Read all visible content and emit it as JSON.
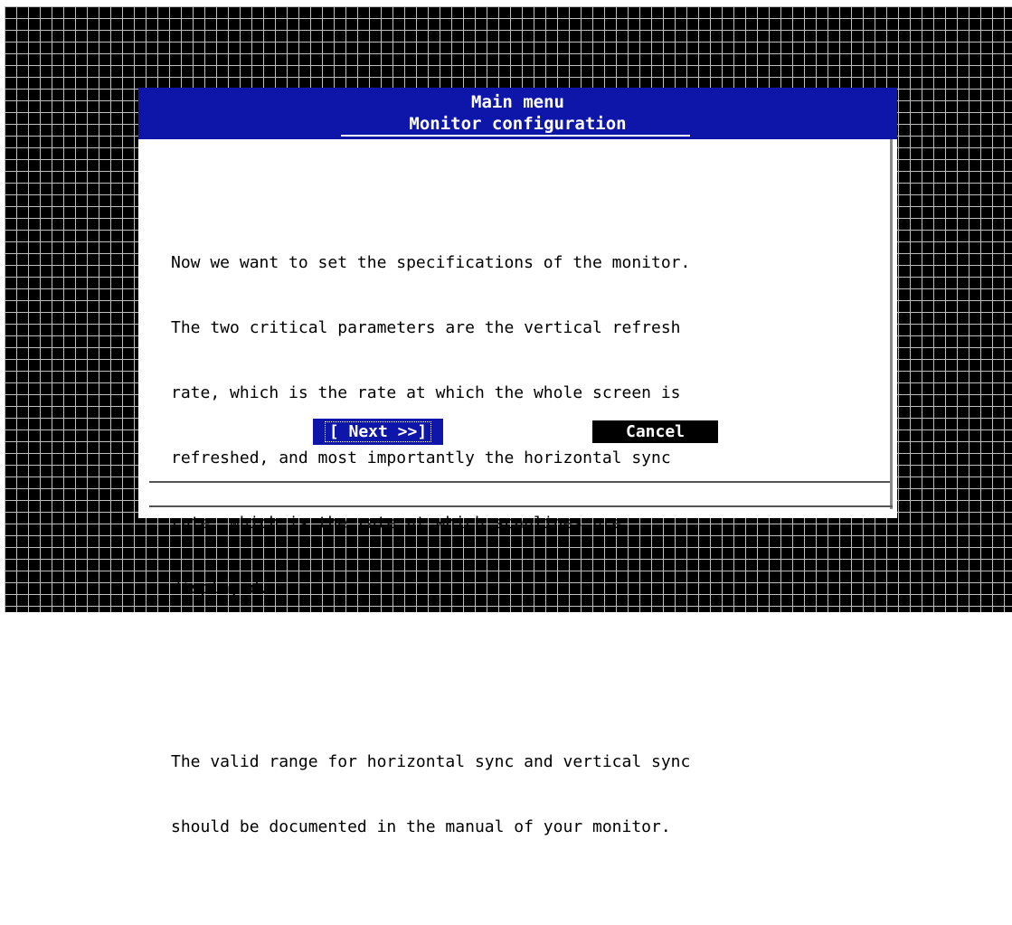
{
  "dialog": {
    "title": "Main menu",
    "subtitle": "Monitor configuration",
    "paragraph1": [
      "Now we want to set the specifications of the monitor.",
      "The two critical parameters are the vertical refresh",
      "rate, which is the rate at which the whole screen is",
      "refreshed, and most importantly the horizontal sync",
      "rate, which is the rate at which scanlines are",
      "displayed."
    ],
    "paragraph2": [
      "The valid range for horizontal sync and vertical sync",
      "should be documented in the manual of your monitor."
    ],
    "buttons": {
      "next_label": "[ Next >>]",
      "cancel_label": "Cancel"
    }
  },
  "colors": {
    "title_bg": "#0d16a8",
    "grid_line": "#bdbdbd",
    "screen_bg": "#000000"
  }
}
